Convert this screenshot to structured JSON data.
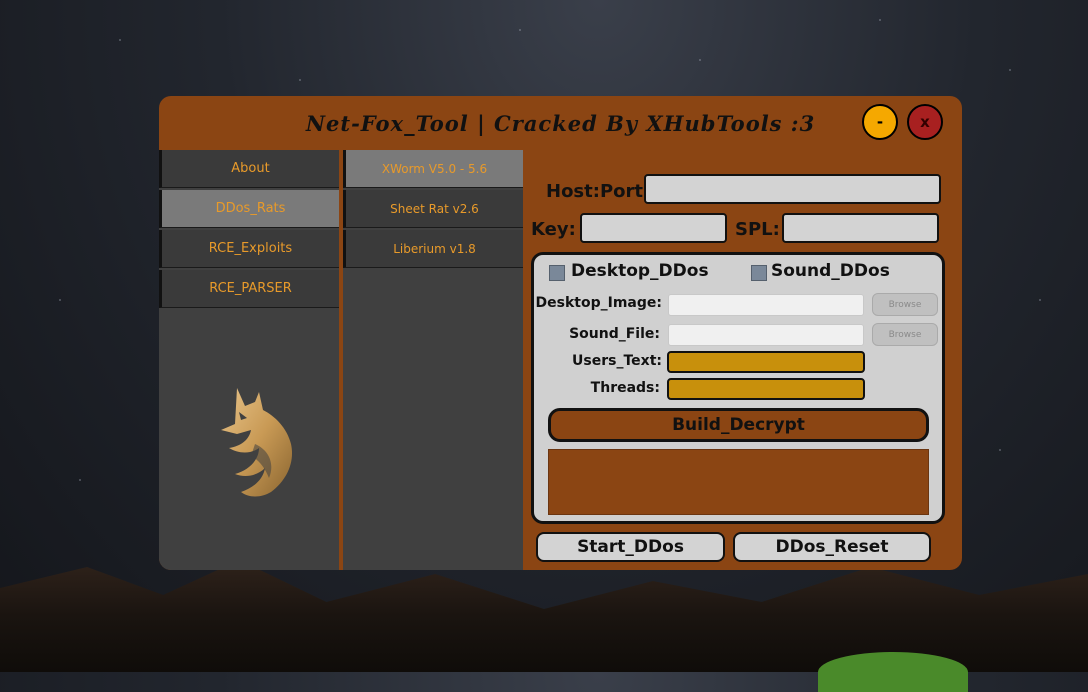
{
  "window": {
    "title": "Net-Fox_Tool | Cracked By XHubTools :3",
    "minimize_label": "-",
    "close_label": "x"
  },
  "sidebar": {
    "items": [
      {
        "label": "About"
      },
      {
        "label": "DDos_Rats"
      },
      {
        "label": "RCE_Exploits"
      },
      {
        "label": "RCE_PARSER"
      }
    ]
  },
  "subnav": {
    "items": [
      {
        "label": "XWorm V5.0 - 5.6"
      },
      {
        "label": "Sheet Rat v2.6"
      },
      {
        "label": "Liberium v1.8"
      }
    ]
  },
  "connection": {
    "host_port_label": "Host:Port",
    "host_port_value": "",
    "key_label": "Key:",
    "key_value": "",
    "spl_label": "SPL:",
    "spl_value": ""
  },
  "panel": {
    "desktop_ddos_label": "Desktop_DDos",
    "sound_ddos_label": "Sound_DDos",
    "desktop_image_label": "Desktop_Image:",
    "sound_file_label": "Sound_File:",
    "browse_label": "Browse",
    "users_text_label": "Users_Text:",
    "threads_label": "Threads:",
    "build_label": "Build_Decrypt"
  },
  "actions": {
    "start_label": "Start_DDos",
    "reset_label": "DDos_Reset"
  },
  "colors": {
    "window_bg": "#8b4513",
    "nav_text": "#e89a2a",
    "gold_field": "#c8900c",
    "minimize": "#f5a800",
    "close": "#a82020"
  }
}
